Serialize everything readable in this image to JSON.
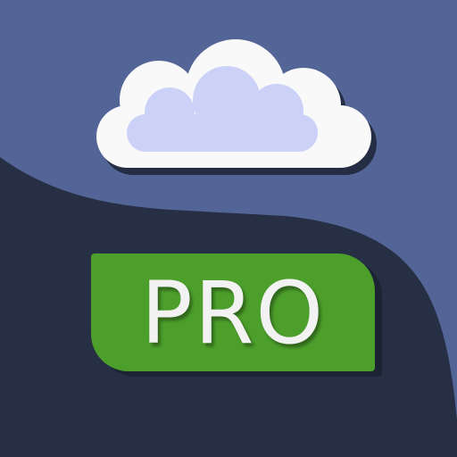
{
  "badge": {
    "label": "PRO"
  },
  "icons": {
    "cloud": "cloud-icon"
  },
  "colors": {
    "sky": "#536597",
    "ground": "#262f44",
    "cloud_outer": "#f9f9f9",
    "cloud_inner": "#ccd2f7",
    "badge": "#4c9f2b"
  }
}
